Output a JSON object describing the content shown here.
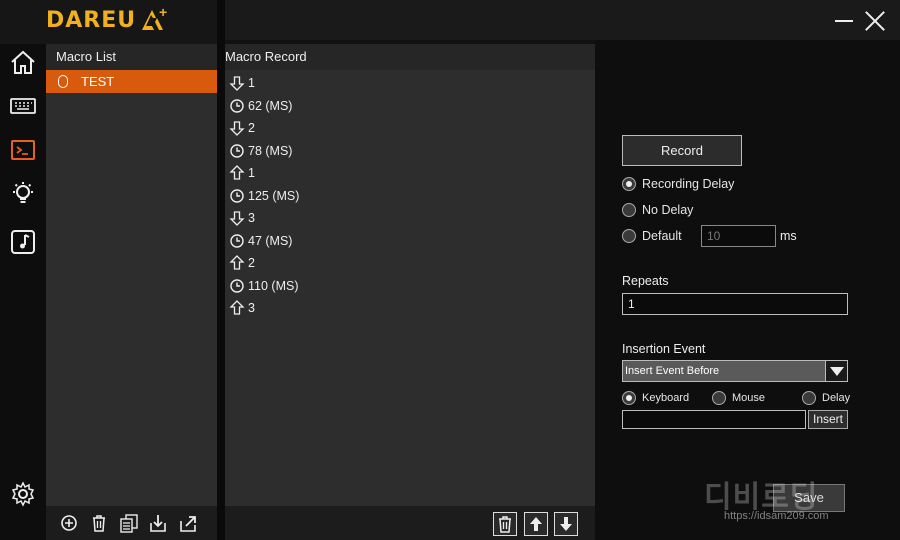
{
  "app": {
    "logo_text": "DAREU",
    "logo_plus": "A+"
  },
  "nav": [
    {
      "icon": "home-icon"
    },
    {
      "icon": "keyboard-icon"
    },
    {
      "icon": "terminal-icon",
      "active": true
    },
    {
      "icon": "lightbulb-icon"
    },
    {
      "icon": "music-icon"
    },
    {
      "icon": "gear-icon"
    }
  ],
  "macro_list": {
    "title": "Macro List",
    "items": [
      {
        "label": "TEST",
        "icon": "mouse-icon",
        "selected": true
      }
    ],
    "toolbar": [
      "add-icon",
      "delete-icon",
      "copy-icon",
      "import-icon",
      "export-icon"
    ]
  },
  "macro_record": {
    "title": "Macro Record",
    "events": [
      {
        "icon": "key-down-icon",
        "text": "1"
      },
      {
        "icon": "clock-icon",
        "text": "62 (MS)"
      },
      {
        "icon": "key-down-icon",
        "text": "2"
      },
      {
        "icon": "clock-icon",
        "text": "78 (MS)"
      },
      {
        "icon": "key-up-icon",
        "text": "1"
      },
      {
        "icon": "clock-icon",
        "text": "125 (MS)"
      },
      {
        "icon": "key-down-icon",
        "text": "3"
      },
      {
        "icon": "clock-icon",
        "text": "47 (MS)"
      },
      {
        "icon": "key-up-icon",
        "text": "2"
      },
      {
        "icon": "clock-icon",
        "text": "110 (MS)"
      },
      {
        "icon": "key-up-icon",
        "text": "3"
      }
    ],
    "toolbar": [
      "delete-icon",
      "move-up-icon",
      "move-down-icon"
    ]
  },
  "settings": {
    "record_label": "Record",
    "delay_options": [
      {
        "label": "Recording Delay",
        "selected": true
      },
      {
        "label": "No Delay",
        "selected": false
      },
      {
        "label": "Default",
        "selected": false
      }
    ],
    "default_delay_value": "10",
    "default_delay_unit": "ms",
    "repeats_label": "Repeats",
    "repeats_value": "1",
    "insertion_label": "Insertion Event",
    "insertion_selected": "Insert Event Before",
    "insert_types": [
      {
        "label": "Keyboard",
        "selected": true
      },
      {
        "label": "Mouse",
        "selected": false
      },
      {
        "label": "Delay",
        "selected": false
      }
    ],
    "insert_value": "",
    "insert_label": "Insert",
    "save_label": "Save"
  },
  "watermark": {
    "big": "디비로딩",
    "small": "https://idsam209.com"
  }
}
